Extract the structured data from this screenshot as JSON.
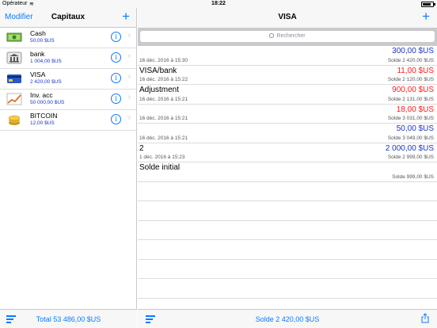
{
  "status": {
    "carrier": "Opérateur",
    "time": "18:22",
    "battery_level": 0.8
  },
  "left": {
    "nav": {
      "edit_label": "Modifier",
      "title": "Capitaux",
      "add_label": "+"
    },
    "accounts": [
      {
        "name": "Cash",
        "amount": "50,00 $US",
        "icon": "cash-icon"
      },
      {
        "name": "bank",
        "amount": "1 004,00 $US",
        "icon": "bank-icon"
      },
      {
        "name": "VISA",
        "amount": "2 420,00 $US",
        "icon": "credit-card-icon"
      },
      {
        "name": "Inv. acc",
        "amount": "50 000,00 $US",
        "icon": "chart-icon"
      },
      {
        "name": "BITCOIN",
        "amount": "12,00 $US",
        "icon": "coins-icon"
      }
    ],
    "info_glyph": "i",
    "chevron_glyph": "›",
    "total": "Total 53 486,00 $US"
  },
  "right": {
    "nav": {
      "title": "VISA",
      "add_label": "+"
    },
    "search": {
      "placeholder": "Rechercher"
    },
    "transactions": [
      {
        "name": "",
        "amount": "300,00 $US",
        "sign": "pos",
        "date": "16 déc. 2016 à 15:30",
        "balance": "Solde 2 420,00 $US"
      },
      {
        "name": "VISA/bank",
        "amount": "11,00 $US",
        "sign": "neg",
        "date": "16 déc. 2016 à 15:22",
        "balance": "Solde 2 120,00 $US"
      },
      {
        "name": "Adjustment",
        "amount": "900,00 $US",
        "sign": "neg",
        "date": "16 déc. 2016 à 15:21",
        "balance": "Solde 2 131,00 $US"
      },
      {
        "name": "",
        "amount": "18,00 $US",
        "sign": "neg",
        "date": "16 déc. 2016 à 15:21",
        "balance": "Solde 3 031,00 $US"
      },
      {
        "name": "",
        "amount": "50,00 $US",
        "sign": "pos",
        "date": "16 déc. 2016 à 15:21",
        "balance": "Solde 3 049,00 $US"
      },
      {
        "name": "2",
        "amount": "2 000,00 $US",
        "sign": "pos",
        "date": "1 déc. 2016 à 15:23",
        "balance": "Solde 2 999,00 $US"
      },
      {
        "name": "Solde initial",
        "amount": "",
        "sign": "pos",
        "date": "",
        "balance": "Solde 999,00 $US"
      }
    ],
    "solde": "Solde 2 420,00 $US"
  },
  "colors": {
    "accent": "#0a7aff",
    "positive": "#1a35c9",
    "negative": "#ff1a1a"
  }
}
